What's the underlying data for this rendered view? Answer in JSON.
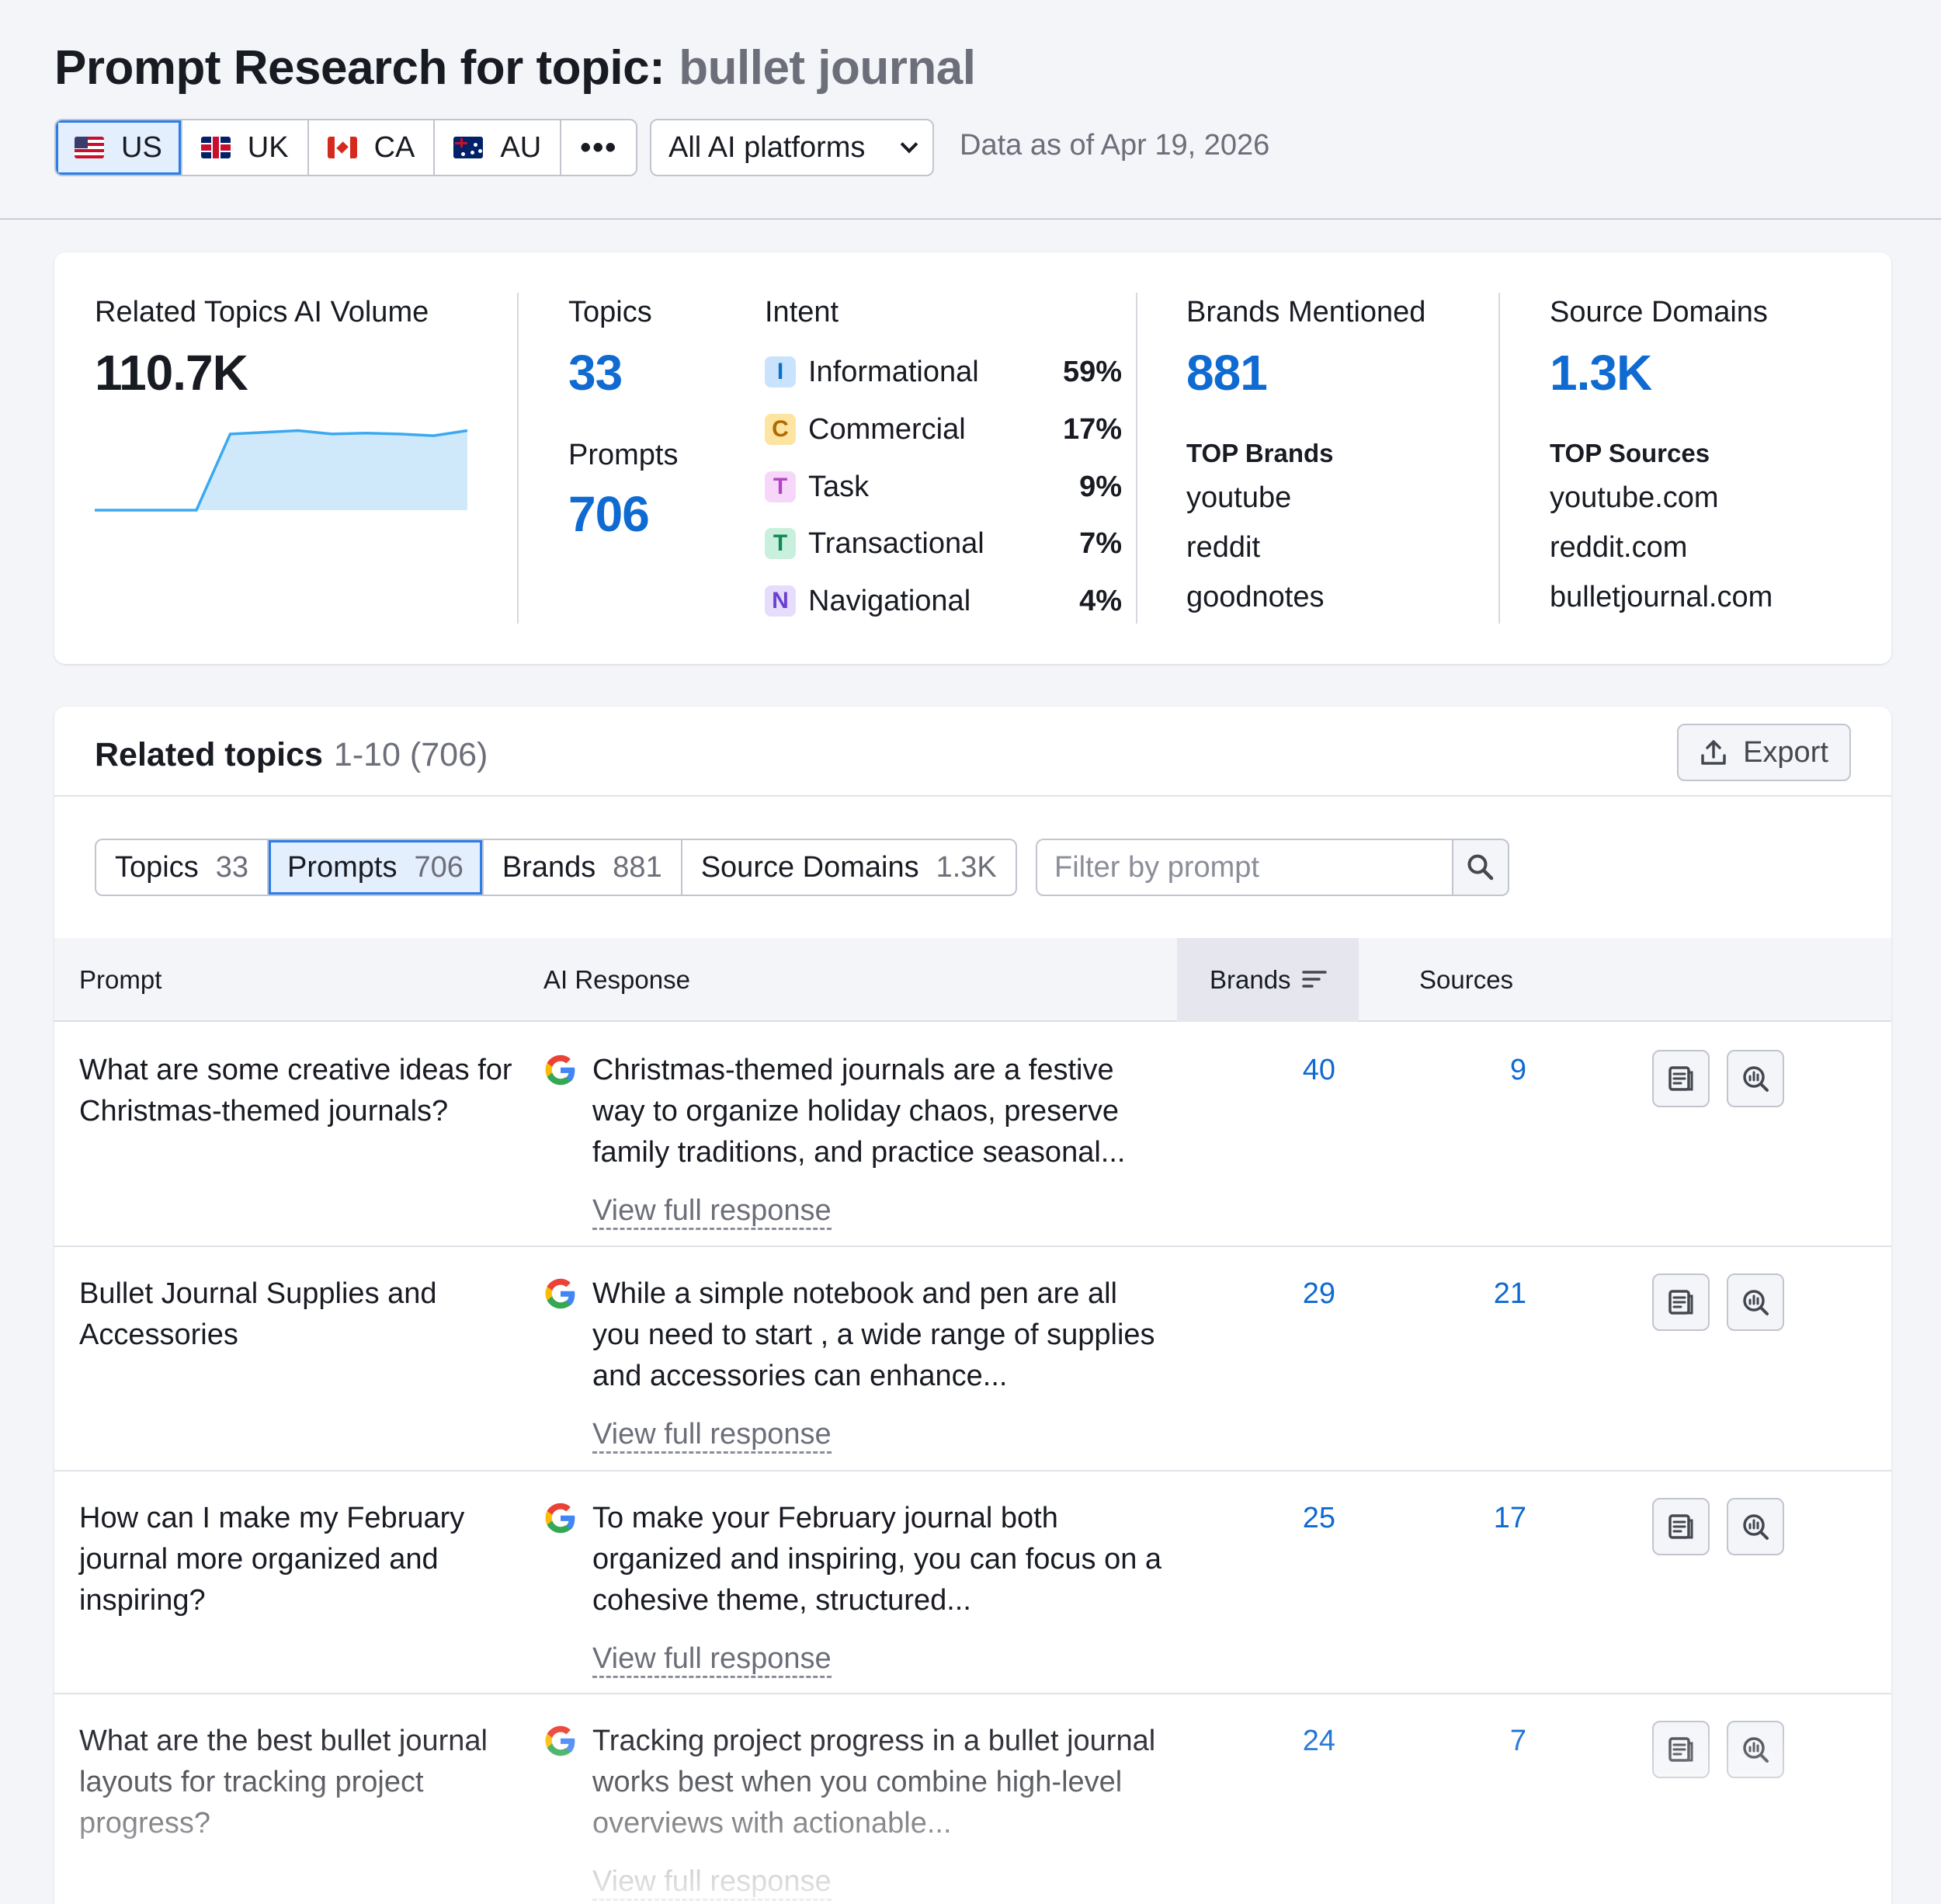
{
  "header": {
    "title": "Prompt Research for topic:",
    "topic": "bullet journal",
    "countries": [
      {
        "code": "US",
        "active": true
      },
      {
        "code": "UK",
        "active": false
      },
      {
        "code": "CA",
        "active": false
      },
      {
        "code": "AU",
        "active": false
      }
    ],
    "more_label": "•••",
    "platform": "All AI platforms",
    "data_date": "Data as of Apr 19, 2026"
  },
  "summary": {
    "volume_label": "Related Topics AI Volume",
    "volume_value": "110.7K",
    "volume_trend": [
      0,
      0,
      0,
      0,
      0.9,
      0.92,
      0.94,
      0.9,
      0.91,
      0.9,
      0.88,
      0.94
    ],
    "topics_label": "Topics",
    "topics_value": "33",
    "prompts_label": "Prompts",
    "prompts_value": "706",
    "intent_label": "Intent",
    "intents": [
      {
        "letter": "I",
        "name": "Informational",
        "pct": "59%",
        "bg": "#c8e3fb",
        "fg": "#0a6fd1"
      },
      {
        "letter": "C",
        "name": "Commercial",
        "pct": "17%",
        "bg": "#fde4a1",
        "fg": "#b06b00"
      },
      {
        "letter": "T",
        "name": "Task",
        "pct": "9%",
        "bg": "#f6d6f9",
        "fg": "#b143c4"
      },
      {
        "letter": "T",
        "name": "Transactional",
        "pct": "7%",
        "bg": "#c9f0dc",
        "fg": "#0f8a52"
      },
      {
        "letter": "N",
        "name": "Navigational",
        "pct": "4%",
        "bg": "#e6dcfc",
        "fg": "#6c3fd1"
      }
    ],
    "brands_label": "Brands Mentioned",
    "brands_value": "881",
    "top_brands_label": "TOP Brands",
    "top_brands": [
      "youtube",
      "reddit",
      "goodnotes"
    ],
    "sources_label": "Source Domains",
    "sources_value": "1.3K",
    "top_sources_label": "TOP Sources",
    "top_sources": [
      "youtube.com",
      "reddit.com",
      "bulletjournal.com"
    ]
  },
  "related": {
    "title": "Related topics",
    "range": "1-10 (706)",
    "export_label": "Export",
    "tabs": [
      {
        "label": "Topics",
        "count": "33"
      },
      {
        "label": "Prompts",
        "count": "706"
      },
      {
        "label": "Brands",
        "count": "881"
      },
      {
        "label": "Source Domains",
        "count": "1.3K"
      }
    ],
    "filter_placeholder": "Filter by prompt",
    "columns": {
      "prompt": "Prompt",
      "response": "AI Response",
      "brands": "Brands",
      "sources": "Sources"
    },
    "view_full_label": "View full response",
    "rows": [
      {
        "prompt": "What are some creative ideas for Christmas-themed journals?",
        "response": "Christmas-themed journals are a festive way to organize holiday chaos, preserve family traditions, and practice seasonal...",
        "brands": "40",
        "sources": "9"
      },
      {
        "prompt": "Bullet Journal Supplies and Accessories",
        "response": "While a simple notebook and pen are all you need to start , a wide range of supplies and accessories can enhance...",
        "brands": "29",
        "sources": "21"
      },
      {
        "prompt": "How can I make my February journal more organized and inspiring?",
        "response": "To make your February journal both organized and inspiring, you can focus on a cohesive theme, structured...",
        "brands": "25",
        "sources": "17"
      },
      {
        "prompt": "What are the best bullet journal layouts for tracking project progress?",
        "response": "Tracking project progress in a bullet journal works best when you combine high-level overviews with actionable...",
        "brands": "24",
        "sources": "7"
      }
    ]
  }
}
